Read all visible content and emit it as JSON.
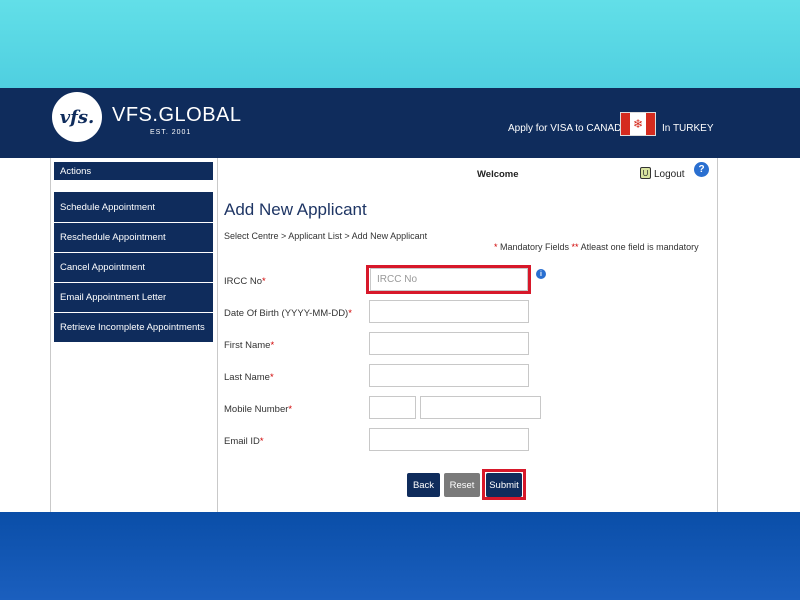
{
  "header": {
    "logo_text": "vfs.",
    "brand_name": "VFS.GLOBAL",
    "brand_est": "EST. 2001",
    "apply_text": "Apply for VISA to CANADA",
    "country_text": "In TURKEY",
    "flag_icon": "canada-flag-icon"
  },
  "sidebar": {
    "actions_label": "Actions",
    "items": [
      {
        "label": "Schedule Appointment"
      },
      {
        "label": "Reschedule Appointment"
      },
      {
        "label": "Cancel Appointment"
      },
      {
        "label": "Email Appointment Letter"
      },
      {
        "label": "Retrieve Incomplete Appointments"
      }
    ]
  },
  "topbar": {
    "welcome_label": "Welcome",
    "logout_label": "Logout",
    "help_icon": "?"
  },
  "main": {
    "title": "Add New Applicant",
    "breadcrumb": "Select Centre   >  Applicant List   >  Add New Applicant",
    "mandatory_star": "*",
    "mandatory_text": " Mandatory Fields ",
    "atleast_star": "**",
    "atleast_text": " Atleast one field is mandatory"
  },
  "form": {
    "ircc": {
      "label": "IRCC No",
      "star": "*",
      "placeholder": "IRCC No",
      "value": ""
    },
    "dob": {
      "label": "Date Of Birth (YYYY-MM-DD)",
      "star": "*",
      "value": ""
    },
    "first_name": {
      "label": "First Name",
      "star": "*",
      "value": ""
    },
    "last_name": {
      "label": "Last Name",
      "star": "*",
      "value": ""
    },
    "mobile": {
      "label": "Mobile Number",
      "star": "*",
      "code_value": "",
      "number_value": ""
    },
    "email": {
      "label": "Email ID",
      "star": "*",
      "value": ""
    },
    "info_icon": "i"
  },
  "buttons": {
    "back": "Back",
    "reset": "Reset",
    "submit": "Submit"
  },
  "colors": {
    "navy": "#0f2c5c",
    "cyan": "#4fcfe0",
    "highlight_red": "#d7182a",
    "reset_gray": "#7a7a7a"
  }
}
